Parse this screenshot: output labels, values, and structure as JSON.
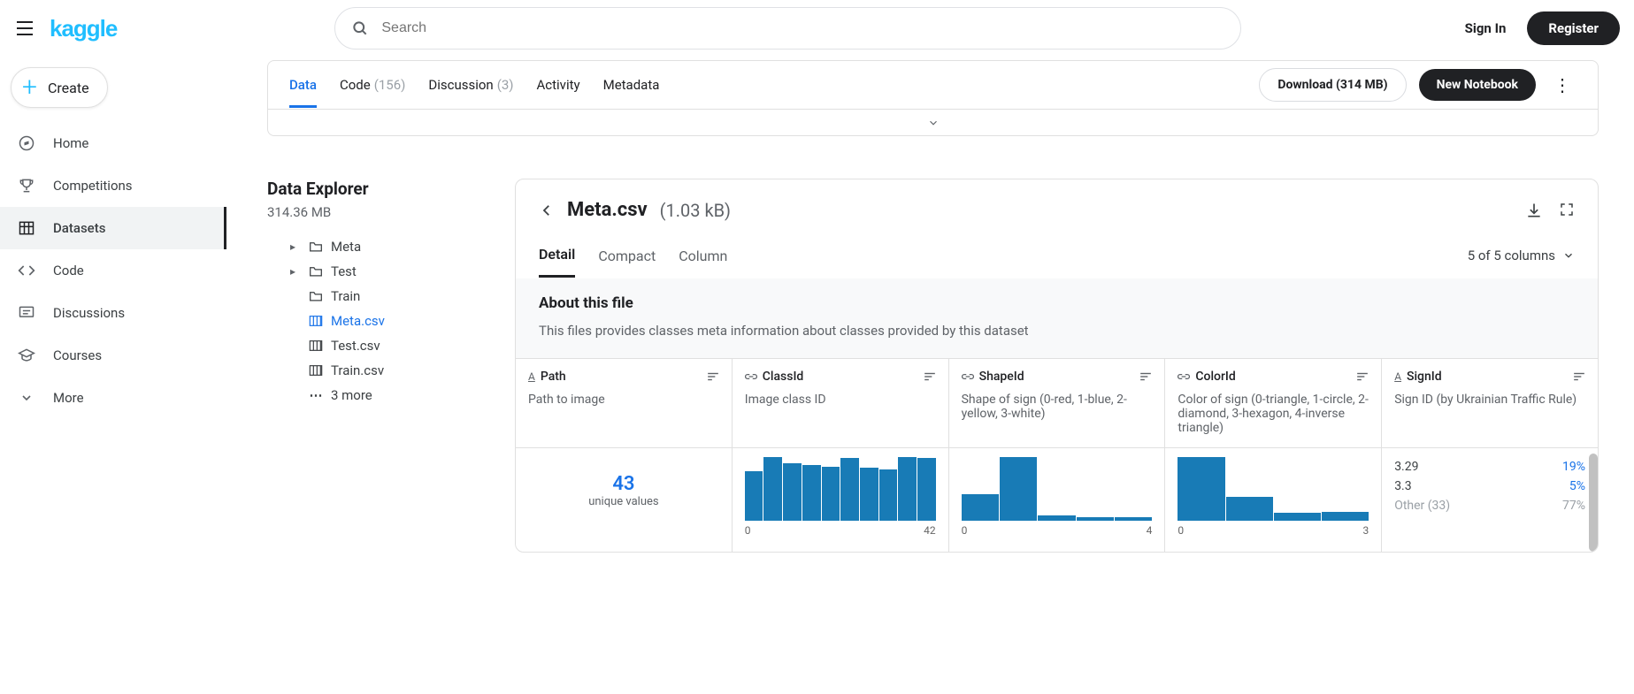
{
  "header": {
    "logo": "kaggle",
    "search_placeholder": "Search",
    "signin": "Sign In",
    "register": "Register"
  },
  "sidebar": {
    "create": "Create",
    "items": [
      {
        "label": "Home"
      },
      {
        "label": "Competitions"
      },
      {
        "label": "Datasets"
      },
      {
        "label": "Code"
      },
      {
        "label": "Discussions"
      },
      {
        "label": "Courses"
      },
      {
        "label": "More"
      }
    ]
  },
  "tabs": {
    "data": "Data",
    "code": "Code",
    "code_count": "(156)",
    "discussion": "Discussion",
    "discussion_count": "(3)",
    "activity": "Activity",
    "metadata": "Metadata",
    "download": "Download (314 MB)",
    "new_notebook": "New Notebook"
  },
  "explorer": {
    "title": "Data Explorer",
    "size": "314.36 MB",
    "items": [
      {
        "kind": "folder",
        "label": "Meta",
        "caret": true
      },
      {
        "kind": "folder",
        "label": "Test",
        "caret": true
      },
      {
        "kind": "folder",
        "label": "Train",
        "caret": false
      },
      {
        "kind": "file",
        "label": "Meta.csv",
        "selected": true
      },
      {
        "kind": "file",
        "label": "Test.csv"
      },
      {
        "kind": "file",
        "label": "Train.csv"
      },
      {
        "kind": "more",
        "label": "3 more"
      }
    ]
  },
  "file": {
    "name": "Meta.csv",
    "size": "(1.03 kB)",
    "view_tabs": {
      "detail": "Detail",
      "compact": "Compact",
      "column": "Column"
    },
    "cols_count": "5 of 5 columns",
    "about_title": "About this file",
    "about_desc": "This files provides classes meta information about classes provided by this dataset",
    "columns": [
      {
        "type": "text",
        "name": "Path",
        "desc": "Path to image",
        "summary": {
          "kind": "unique",
          "value": "43",
          "label": "unique values"
        }
      },
      {
        "type": "link",
        "name": "ClassId",
        "desc": "Image class ID",
        "summary": {
          "kind": "hist",
          "min": "0",
          "max": "42",
          "bars": [
            78,
            100,
            90,
            88,
            85,
            98,
            83,
            80,
            100,
            98
          ]
        }
      },
      {
        "type": "link",
        "name": "ShapeId",
        "desc": "Shape of sign (0-red, 1-blue, 2-yellow, 3-white)",
        "summary": {
          "kind": "hist",
          "min": "0",
          "max": "4",
          "bars": [
            42,
            100,
            8,
            6,
            6
          ]
        }
      },
      {
        "type": "link",
        "name": "ColorId",
        "desc": "Color of sign (0-triangle, 1-circle, 2-diamond, 3-hexagon, 4-inverse triangle)",
        "summary": {
          "kind": "hist",
          "min": "0",
          "max": "3",
          "bars": [
            100,
            38,
            12,
            14
          ]
        }
      },
      {
        "type": "text",
        "name": "SignId",
        "desc": "Sign ID (by Ukrainian Traffic Rule)",
        "summary": {
          "kind": "values",
          "rows": [
            {
              "v": "3.29",
              "p": "19%"
            },
            {
              "v": "3.3",
              "p": "5%"
            },
            {
              "v": "Other (33)",
              "p": "77%",
              "other": true
            }
          ]
        }
      }
    ]
  }
}
